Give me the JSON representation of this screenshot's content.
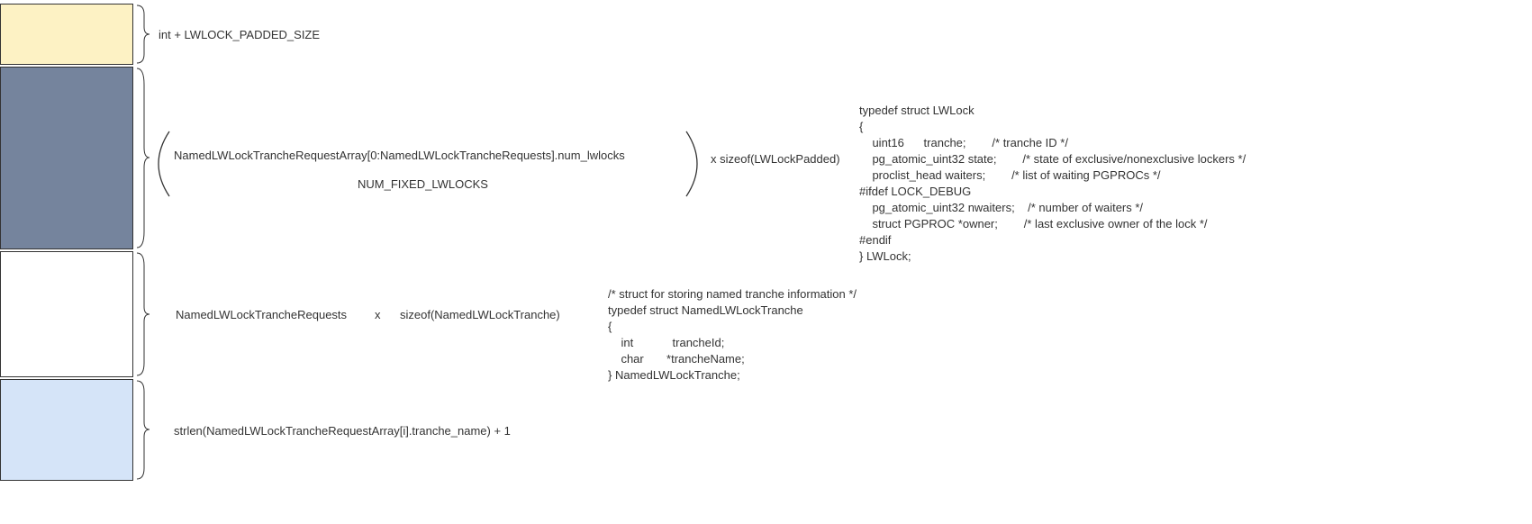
{
  "blocks": {
    "b1": {
      "color": "#fdf2c4"
    },
    "b2": {
      "color": "#75849d"
    },
    "b3": {
      "color": "#ffffff"
    },
    "b4": {
      "color": "#d5e4f8"
    }
  },
  "labels": {
    "row1": "int + LWLOCK_PADDED_SIZE",
    "row2_inner_top": "NamedLWLockTrancheRequestArray[0:NamedLWLockTrancheRequests].num_lwlocks",
    "row2_inner_bottom": "NUM_FIXED_LWLOCKS",
    "row2_mult": "x sizeof(LWLockPadded)",
    "row3_left": "NamedLWLockTrancheRequests",
    "row3_x": "x",
    "row3_right": "sizeof(NamedLWLockTranche)",
    "row4": "strlen(NamedLWLockTrancheRequestArray[i].tranche_name) + 1"
  },
  "code": {
    "lwlock": "typedef struct LWLock\n{\n    uint16      tranche;        /* tranche ID */\n    pg_atomic_uint32 state;        /* state of exclusive/nonexclusive lockers */\n    proclist_head waiters;        /* list of waiting PGPROCs */\n#ifdef LOCK_DEBUG\n    pg_atomic_uint32 nwaiters;    /* number of waiters */\n    struct PGPROC *owner;        /* last exclusive owner of the lock */\n#endif\n} LWLock;",
    "named_tranche": "/* struct for storing named tranche information */\ntypedef struct NamedLWLockTranche\n{\n    int            trancheId;\n    char       *trancheName;\n} NamedLWLockTranche;"
  }
}
